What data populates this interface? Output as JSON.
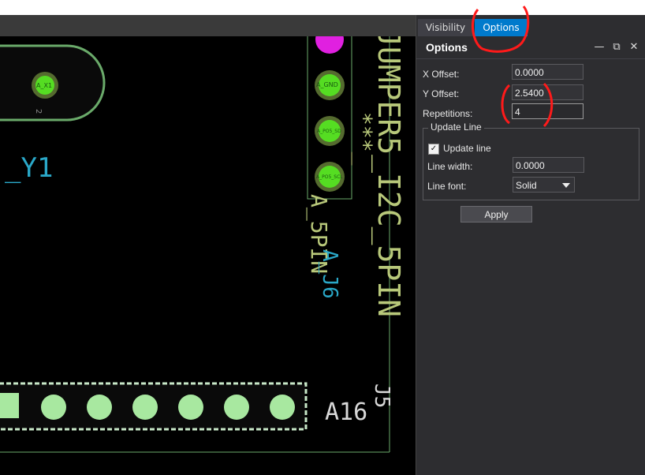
{
  "tabs": [
    {
      "label": "Visibility"
    },
    {
      "label": "Options"
    }
  ],
  "panel": {
    "title": "Options",
    "header_icons": [
      "minimize-icon",
      "restore-icon",
      "close-icon"
    ],
    "x_offset": {
      "label": "X Offset:",
      "value": "0.0000"
    },
    "y_offset": {
      "label": "Y Offset:",
      "value": "2.5400"
    },
    "repetitions": {
      "label": "Repetitions:",
      "value": "4"
    },
    "update_line_group": {
      "title": "Update Line",
      "checkbox_label": "Update line",
      "checked": true,
      "line_width": {
        "label": "Line width:",
        "value": "0.0000"
      },
      "line_font": {
        "label": "Line font:",
        "value": "Solid"
      }
    },
    "apply_label": "Apply"
  },
  "canvas": {
    "labels": {
      "pad_x1": "A_X1",
      "pad_gnd": "A_GND",
      "pad_sd": "A_PO5_SD",
      "pad_scl": "A_PO5_SCL",
      "y1_text": "_Y1",
      "jumper_text": "JUMPER5_I2C_5PIN",
      "a_j6_text": "A_J6",
      "a_5pin_text": "A_5PIN",
      "a16_text": "A16",
      "j5_text": "J5",
      "num_2": "2",
      "stars": "***_"
    },
    "colors": {
      "pad": "#55dd22",
      "magenta": "#e020e0",
      "outline": "#6aaa6a",
      "silk": "#c8d88a",
      "cyan": "#2aa8c8",
      "annotation": "#ff1a1a"
    }
  }
}
